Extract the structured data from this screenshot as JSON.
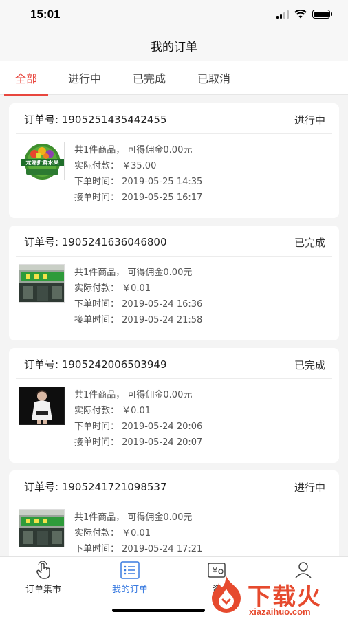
{
  "status": {
    "time": "15:01"
  },
  "nav": {
    "title": "我的订单"
  },
  "tabs": [
    {
      "label": "全部",
      "active": true
    },
    {
      "label": "进行中",
      "active": false
    },
    {
      "label": "已完成",
      "active": false
    },
    {
      "label": "已取消",
      "active": false
    }
  ],
  "orders": [
    {
      "order_no_label": "订单号: 1905251435442455",
      "status": "进行中",
      "thumb_icon": "fruit-shop-logo",
      "thumb_text": "龙湖折鲜水果",
      "summary": "共1件商品， 可得佣金0.00元",
      "paid": "实际付款： ￥35.00",
      "order_time": "下单时间： 2019-05-25 14:35",
      "accept_time": "接单时间： 2019-05-25 16:17"
    },
    {
      "order_no_label": "订单号: 1905241636046800",
      "status": "已完成",
      "thumb_icon": "storefront-photo",
      "summary": "共1件商品， 可得佣金0.00元",
      "paid": "实际付款： ￥0.01",
      "order_time": "下单时间： 2019-05-24 16:36",
      "accept_time": "接单时间： 2019-05-24 21:58"
    },
    {
      "order_no_label": "订单号: 1905242006503949",
      "status": "已完成",
      "thumb_icon": "person-photo",
      "summary": "共1件商品， 可得佣金0.00元",
      "paid": "实际付款： ￥0.01",
      "order_time": "下单时间： 2019-05-24 20:06",
      "accept_time": "接单时间： 2019-05-24 20:07"
    },
    {
      "order_no_label": "订单号: 1905241721098537",
      "status": "进行中",
      "thumb_icon": "storefront-photo",
      "summary": "共1件商品， 可得佣金0.00元",
      "paid": "实际付款： ￥0.01",
      "order_time": "下单时间： 2019-05-24 17:21",
      "accept_time": ""
    }
  ],
  "bottom_nav": [
    {
      "label": "订单集市",
      "icon": "hand-tap-icon",
      "active": false
    },
    {
      "label": "我的订单",
      "icon": "order-list-icon",
      "active": true
    },
    {
      "label": "资",
      "icon": "wallet-icon",
      "active": false
    },
    {
      "label": "",
      "icon": "user-icon",
      "active": false
    }
  ],
  "watermark": {
    "text": "下载火",
    "sub": "xiazaihuo.com"
  },
  "colors": {
    "accent": "#e8463e",
    "active_nav": "#3a7be0",
    "watermark": "#e64a2e"
  }
}
